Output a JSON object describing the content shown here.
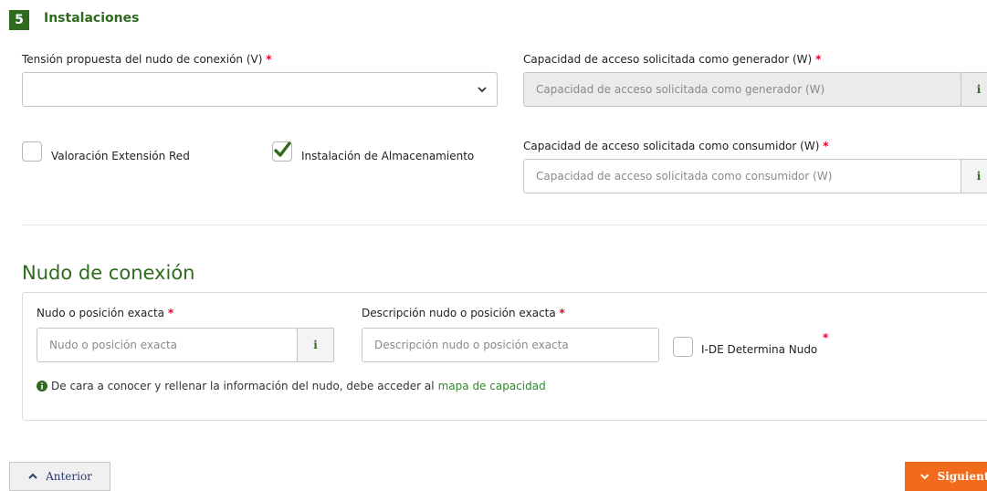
{
  "section": {
    "number": "5",
    "title": "Instalaciones"
  },
  "tension": {
    "label": "Tensión propuesta del nudo de conexión (V)",
    "required": "*",
    "value": ""
  },
  "cap_gen": {
    "label": "Capacidad de acceso solicitada como generador (W)",
    "required": "*",
    "placeholder": "Capacidad de acceso solicitada como generador (W)",
    "info": "i",
    "disabled": true
  },
  "cap_con": {
    "label": "Capacidad de acceso solicitada como consumidor (W)",
    "required": "*",
    "placeholder": "Capacidad de acceso solicitada como consumidor (W)",
    "info": "i"
  },
  "checkboxes": {
    "valoracion": {
      "label": "Valoración Extensión Red",
      "checked": false
    },
    "almacenamiento": {
      "label": "Instalación de Almacenamiento",
      "checked": true
    }
  },
  "nudo": {
    "heading": "Nudo de conexión",
    "posicion": {
      "label": "Nudo o posición exacta",
      "required": "*",
      "placeholder": "Nudo o posición exacta",
      "info": "i"
    },
    "descripcion": {
      "label": "Descripción nudo o posición exacta",
      "required": "*",
      "placeholder": "Descripción nudo o posición exacta"
    },
    "ide": {
      "label": "I-DE Determina Nudo",
      "required": "*",
      "checked": false
    },
    "note_text": "De cara a conocer y rellenar la información del nudo, debe acceder al",
    "note_link": "mapa de capacidad"
  },
  "nav": {
    "prev": "Anterior",
    "next": "Siguiente"
  },
  "colors": {
    "brand_green": "#2f6b1f",
    "required_red": "#e4002b",
    "next_orange": "#f26a1b"
  }
}
